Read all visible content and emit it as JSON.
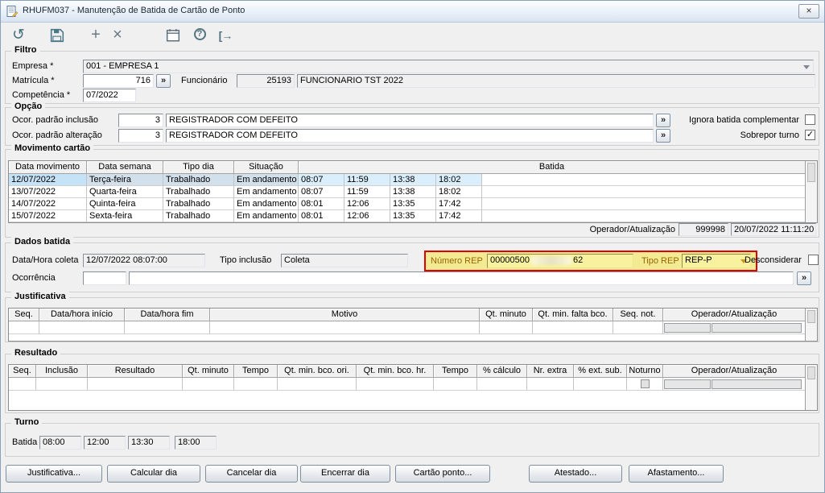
{
  "window": {
    "title": "RHUFM037 - Manutenção de Batida de Cartão de Ponto"
  },
  "glyphs": {
    "refresh": "↺",
    "add": "+",
    "delete": "×",
    "help": "?",
    "exit": "[→",
    "expand": "»",
    "check": "✓",
    "close": "×"
  },
  "filtro": {
    "legend": "Filtro",
    "empresa_label": "Empresa *",
    "empresa_value": "001 - EMPRESA 1",
    "matricula_label": "Matrícula *",
    "matricula_value": "716",
    "funcionario_label": "Funcionário",
    "funcionario_code": "25193",
    "funcionario_nome": "FUNCIONARIO TST 2022",
    "competencia_label": "Competência *",
    "competencia_value": "07/2022"
  },
  "opcao": {
    "legend": "Opção",
    "inclusao_label": "Ocor. padrão inclusão",
    "inclusao_codigo": "3",
    "inclusao_descricao": "REGISTRADOR COM DEFEITO",
    "alteracao_label": "Ocor. padrão alteração",
    "alteracao_codigo": "3",
    "alteracao_descricao": "REGISTRADOR COM DEFEITO",
    "ignora_label": "Ignora batida complementar",
    "ignora_checked": false,
    "sobrepor_label": "Sobrepor turno",
    "sobrepor_checked": true
  },
  "movimento": {
    "legend": "Movimento cartão",
    "headers": [
      "Data movimento",
      "Data semana",
      "Tipo dia",
      "Situação",
      "Batida"
    ],
    "rows": [
      {
        "data": "12/07/2022",
        "semana": "Terça-feira",
        "tipo": "Trabalhado",
        "situacao": "Em andamento",
        "b0": "08:07",
        "b1": "11:59",
        "b2": "13:38",
        "b3": "18:02"
      },
      {
        "data": "13/07/2022",
        "semana": "Quarta-feira",
        "tipo": "Trabalhado",
        "situacao": "Em andamento",
        "b0": "08:07",
        "b1": "11:59",
        "b2": "13:38",
        "b3": "18:02"
      },
      {
        "data": "14/07/2022",
        "semana": "Quinta-feira",
        "tipo": "Trabalhado",
        "situacao": "Em andamento",
        "b0": "08:01",
        "b1": "12:06",
        "b2": "13:35",
        "b3": "17:42"
      },
      {
        "data": "15/07/2022",
        "semana": "Sexta-feira",
        "tipo": "Trabalhado",
        "situacao": "Em andamento",
        "b0": "08:01",
        "b1": "12:06",
        "b2": "13:35",
        "b3": "17:42"
      }
    ],
    "operador_label": "Operador/Atualização",
    "operador_value": "999998",
    "atualizacao_value": "20/07/2022 11:11:20"
  },
  "dados_batida": {
    "legend": "Dados batida",
    "data_hora_label": "Data/Hora coleta",
    "data_hora_value": "12/07/2022 08:07:00",
    "tipo_inclusao_label": "Tipo inclusão",
    "tipo_inclusao_value": "Coleta",
    "numero_rep_label": "Número REP",
    "numero_rep_prefix": "00000500",
    "numero_rep_suffix": "62",
    "tipo_rep_label": "Tipo REP",
    "tipo_rep_value": "REP-P",
    "desconsiderar_label": "Desconsiderar",
    "desconsiderar_checked": false,
    "ocorrencia_label": "Ocorrência",
    "ocorrencia_codigo": "",
    "ocorrencia_descricao": ""
  },
  "justificativa": {
    "legend": "Justificativa",
    "headers": [
      "Seq.",
      "Data/hora início",
      "Data/hora fim",
      "Motivo",
      "Qt. minuto",
      "Qt. min. falta bco.",
      "Seq. not.",
      "Operador/Atualização"
    ]
  },
  "resultado": {
    "legend": "Resultado",
    "headers": [
      "Seq.",
      "Inclusão",
      "Resultado",
      "Qt. minuto",
      "Tempo",
      "Qt. min. bco. ori.",
      "Qt. min. bco. hr.",
      "Tempo",
      "% cálculo",
      "Nr. extra",
      "% ext. sub.",
      "Noturno",
      "Operador/Atualização"
    ]
  },
  "turno": {
    "legend": "Turno",
    "batida_label": "Batida",
    "batidas": [
      "08:00",
      "12:00",
      "13:30",
      "18:00"
    ]
  },
  "buttons": [
    "Justificativa...",
    "Calcular dia",
    "Cancelar dia",
    "Encerrar dia",
    "Cartão ponto...",
    "Atestado...",
    "Afastamento..."
  ],
  "colors": {
    "highlight_border": "#e10000",
    "highlight_fill": "#f2eb94",
    "selection": "#cde6f7"
  }
}
